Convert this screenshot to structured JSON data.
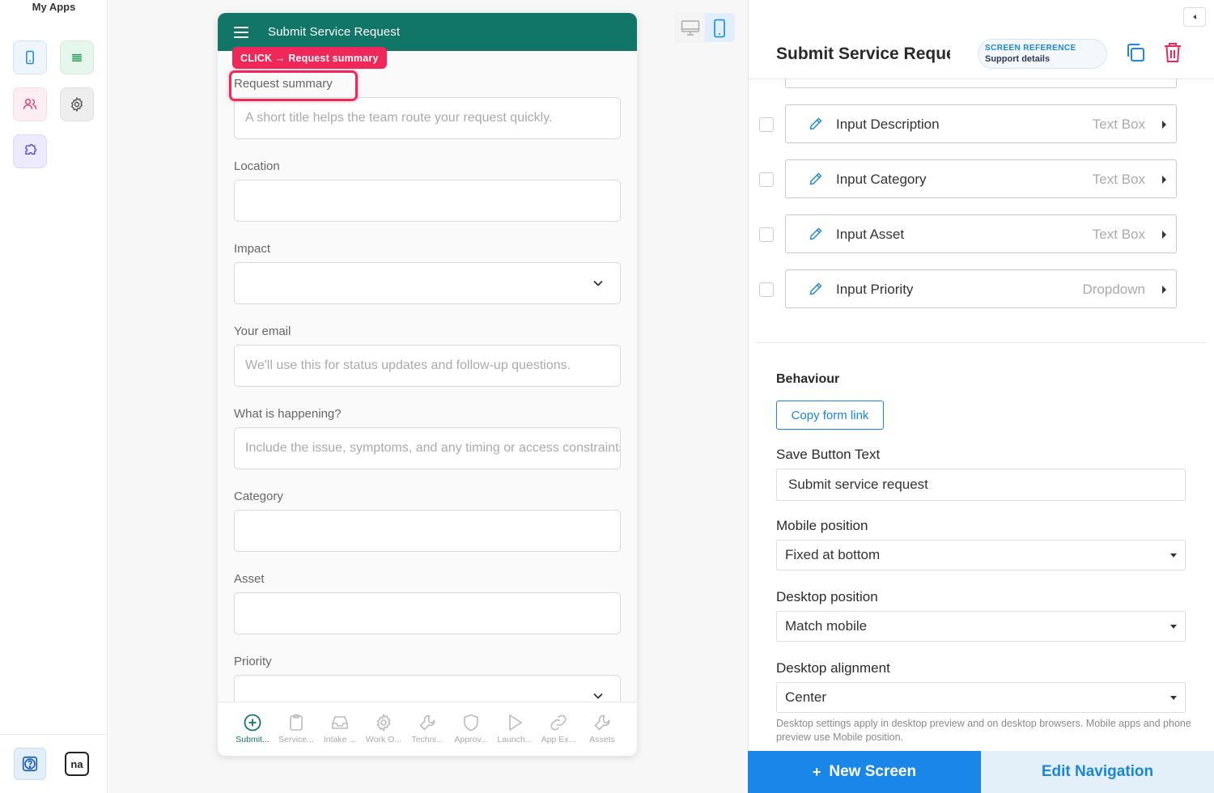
{
  "sidebar": {
    "title": "My Apps",
    "buttons": [
      {
        "icon": "mobile-app-icon",
        "color": "#1a86d8",
        "bg": "#eef5fd"
      },
      {
        "icon": "list-icon",
        "color": "#1c9a4e",
        "bg": "#e6f6ec"
      },
      {
        "icon": "users-icon",
        "color": "#d8437a",
        "bg": "#fdeef3"
      },
      {
        "icon": "gear-icon",
        "color": "#555555",
        "bg": "#eeeeee"
      },
      {
        "icon": "puzzle-icon",
        "color": "#5b4dd6",
        "bg": "#eceafc"
      }
    ],
    "help_icon": "help-icon",
    "brand_badge": "na"
  },
  "phone": {
    "title": "Submit Service Request",
    "header_color": "#117568",
    "fields": [
      {
        "label": "Request summary",
        "placeholder": "A short title helps the team route your request quickly.",
        "type": "text"
      },
      {
        "label": "Location",
        "placeholder": "",
        "type": "text"
      },
      {
        "label": "Impact",
        "placeholder": "",
        "type": "dropdown"
      },
      {
        "label": "Your email",
        "placeholder": "We'll use this for status updates and follow-up questions.",
        "type": "text"
      },
      {
        "label": "What is happening?",
        "placeholder": "Include the issue, symptoms, and any timing or access constraints.",
        "type": "text"
      },
      {
        "label": "Category",
        "placeholder": "",
        "type": "text"
      },
      {
        "label": "Asset",
        "placeholder": "",
        "type": "text"
      },
      {
        "label": "Priority",
        "placeholder": "",
        "type": "dropdown"
      }
    ],
    "nav": [
      {
        "label": "Submit...",
        "icon": "plus-circle-icon",
        "active": true
      },
      {
        "label": "Service...",
        "icon": "clipboard-icon"
      },
      {
        "label": "Intake ...",
        "icon": "inbox-icon"
      },
      {
        "label": "Work O...",
        "icon": "gear-icon"
      },
      {
        "label": "Techni...",
        "icon": "wrench-icon"
      },
      {
        "label": "Approv...",
        "icon": "shield-icon"
      },
      {
        "label": "Launch...",
        "icon": "play-icon"
      },
      {
        "label": "App Ex...",
        "icon": "link-icon"
      },
      {
        "label": "Assets",
        "icon": "wrench-icon"
      }
    ]
  },
  "annotation": {
    "tag": "CLICK → Request summary",
    "color": "#f0285a"
  },
  "panel": {
    "title": "Submit Service Request",
    "reference_label": "SCREEN REFERENCE",
    "reference_value": "Support details",
    "field_rows": [
      {
        "name": "Input Description",
        "type": "Text Box"
      },
      {
        "name": "Input Category",
        "type": "Text Box"
      },
      {
        "name": "Input Asset",
        "type": "Text Box"
      },
      {
        "name": "Input Priority",
        "type": "Dropdown"
      }
    ],
    "behaviour_heading": "Behaviour",
    "copy_link_label": "Copy form link",
    "save_button_text_label": "Save Button Text",
    "save_button_text_value": "Submit service request",
    "mobile_position_label": "Mobile position",
    "mobile_position_value": "Fixed at bottom",
    "desktop_position_label": "Desktop position",
    "desktop_position_value": "Match mobile",
    "desktop_alignment_label": "Desktop alignment",
    "desktop_alignment_value": "Center",
    "hint": "Desktop settings apply in desktop preview and on desktop browsers. Mobile apps and phone preview use Mobile position.",
    "new_screen_label": "New Screen",
    "edit_navigation_label": "Edit Navigation",
    "accent": "#1a86e8",
    "danger": "#f0285a"
  }
}
